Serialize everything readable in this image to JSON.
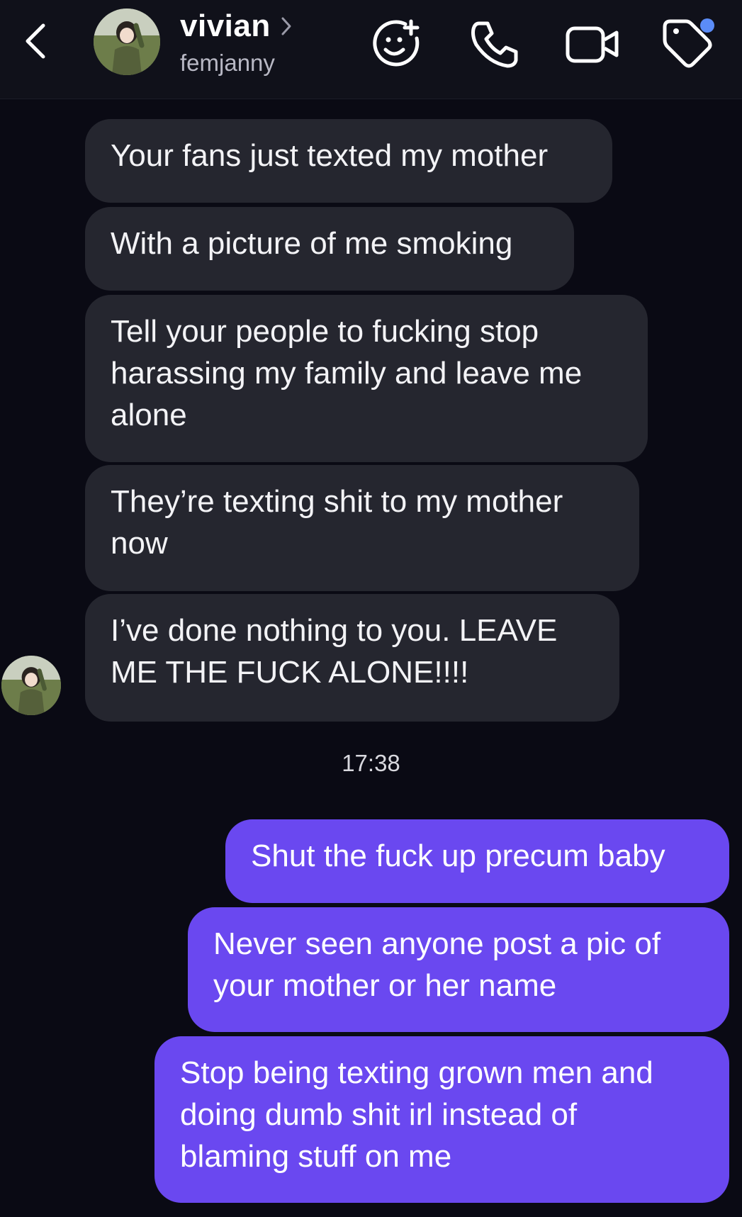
{
  "header": {
    "name": "vivian",
    "handle": "femjanny",
    "icons": [
      "back-chevron-icon",
      "chevron-right-icon",
      "add-reaction-icon",
      "phone-icon",
      "video-camera-icon",
      "tag-icon"
    ]
  },
  "thread": {
    "incoming": [
      "Your fans just texted my mother",
      "With a picture of me smoking",
      "Tell your people to fucking stop\nharassing my family and leave me\nalone",
      "They’re texting shit to my mother\nnow",
      "I’ve done nothing to you. LEAVE\nME THE FUCK ALONE!!!!"
    ],
    "timestamp": "17:38",
    "outgoing": [
      "Shut the fuck up precum baby",
      "Never seen anyone post a pic of\nyour mother or her name",
      "Stop being texting grown men and\ndoing dumb shit irl instead of\nblaming stuff on me"
    ]
  },
  "colors": {
    "background": "#0a0a14",
    "incoming_bubble": "#25262f",
    "outgoing_bubble": "#6a48f0",
    "notification_dot": "#5b8cf7"
  }
}
